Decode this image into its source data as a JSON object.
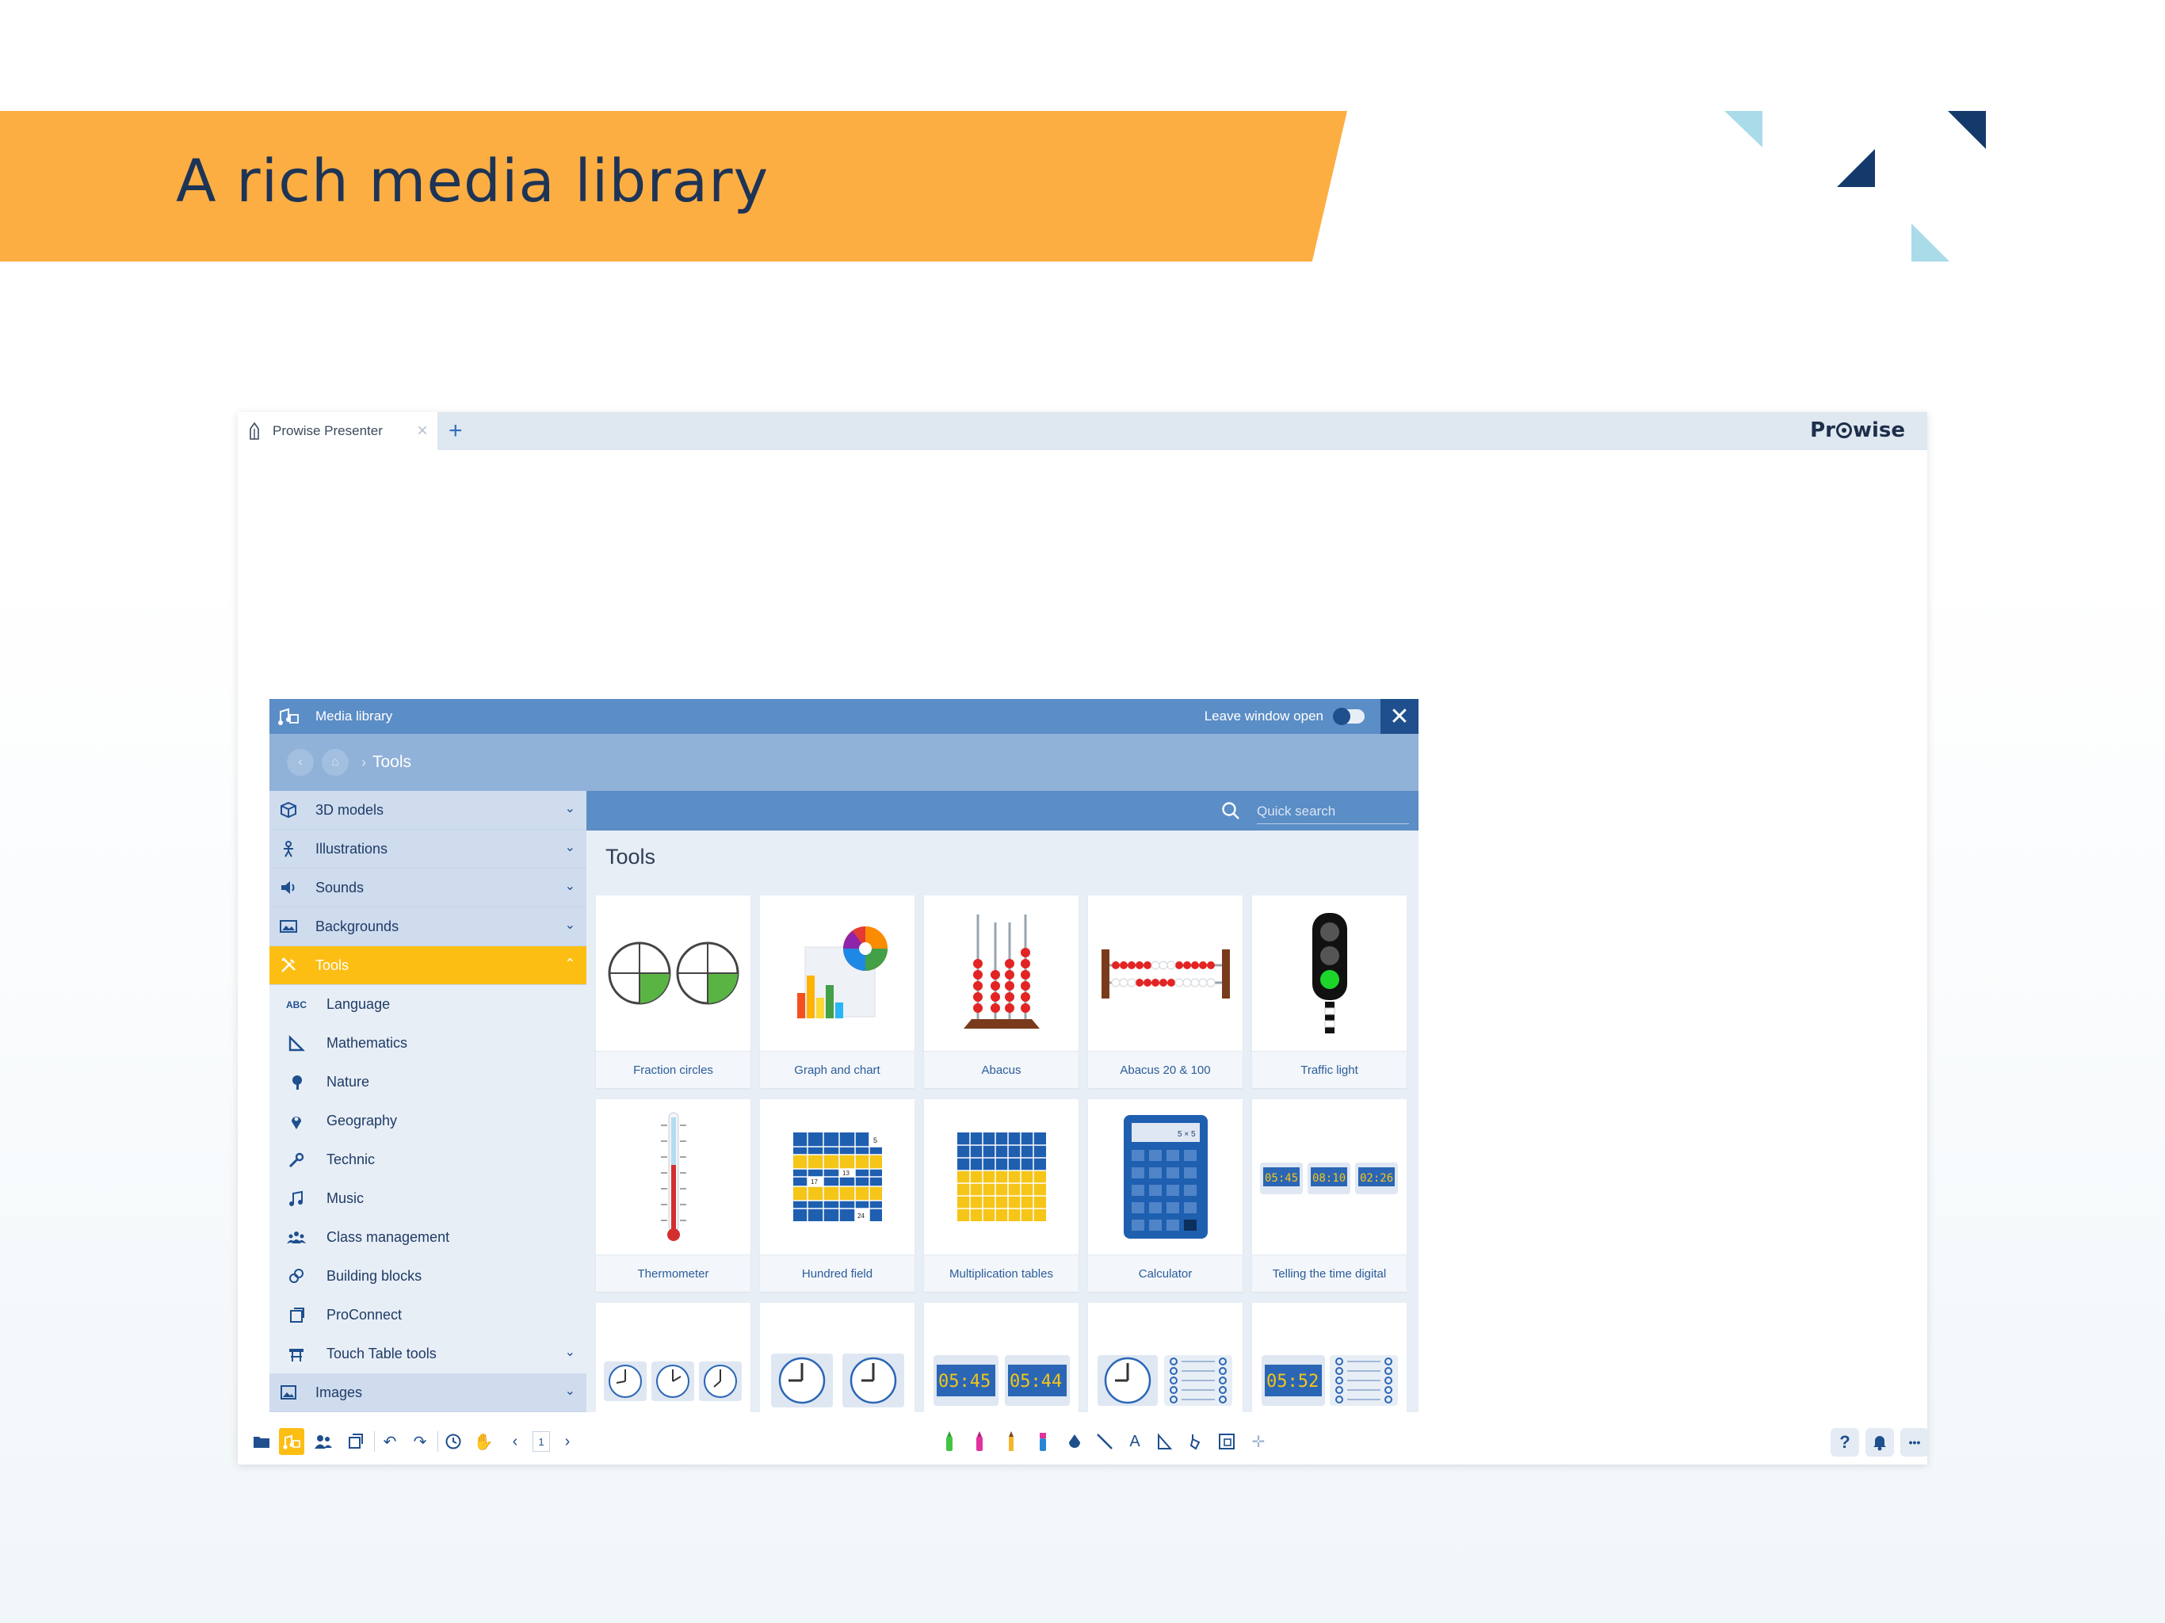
{
  "slide": {
    "title": "A rich media library",
    "accent": "#fdae42",
    "dark": "#143a6b",
    "light": "#a9dbe9"
  },
  "browser": {
    "tab_title": "Prowise Presenter",
    "add_tab": "+",
    "close_tab": "×",
    "brand_left": "Pr",
    "brand_right": "wise"
  },
  "media_library": {
    "title": "Media library",
    "leave_window_label": "Leave window open",
    "leave_window_on": false,
    "close": "✕",
    "breadcrumb": "Tools",
    "search_placeholder": "Quick search",
    "section_title": "Tools",
    "sidebar": [
      {
        "label": "3D models",
        "icon": "cube-icon",
        "level": "top",
        "state": "collapsed"
      },
      {
        "label": "Illustrations",
        "icon": "figure-icon",
        "level": "top",
        "state": "collapsed"
      },
      {
        "label": "Sounds",
        "icon": "speaker-icon",
        "level": "top",
        "state": "collapsed"
      },
      {
        "label": "Backgrounds",
        "icon": "landscape-icon",
        "level": "top",
        "state": "collapsed"
      },
      {
        "label": "Tools",
        "icon": "tools-icon",
        "level": "top",
        "state": "expanded"
      },
      {
        "label": "Language",
        "icon": "abc-icon",
        "level": "sub"
      },
      {
        "label": "Mathematics",
        "icon": "set-square-icon",
        "level": "sub"
      },
      {
        "label": "Nature",
        "icon": "tree-icon",
        "level": "sub"
      },
      {
        "label": "Geography",
        "icon": "location-pin-icon",
        "level": "sub"
      },
      {
        "label": "Technic",
        "icon": "wrench-icon",
        "level": "sub"
      },
      {
        "label": "Music",
        "icon": "music-note-icon",
        "level": "sub"
      },
      {
        "label": "Class management",
        "icon": "group-icon",
        "level": "sub"
      },
      {
        "label": "Building blocks",
        "icon": "blocks-icon",
        "level": "sub"
      },
      {
        "label": "ProConnect",
        "icon": "proconnect-icon",
        "level": "sub"
      },
      {
        "label": "Touch Table tools",
        "icon": "table-icon",
        "level": "sub",
        "state": "collapsed"
      },
      {
        "label": "Images",
        "icon": "image-icon",
        "level": "top",
        "state": "collapsed"
      }
    ],
    "tools": [
      {
        "label": "Fraction circles",
        "icon": "fraction-circles-icon"
      },
      {
        "label": "Graph and chart",
        "icon": "graph-chart-icon"
      },
      {
        "label": "Abacus",
        "icon": "abacus-icon"
      },
      {
        "label": "Abacus 20 & 100",
        "icon": "abacus-horizontal-icon"
      },
      {
        "label": "Traffic light",
        "icon": "traffic-light-icon"
      },
      {
        "label": "Thermometer",
        "icon": "thermometer-icon"
      },
      {
        "label": "Hundred field",
        "icon": "hundred-field-icon"
      },
      {
        "label": "Multiplication tables",
        "icon": "multiplication-grid-icon"
      },
      {
        "label": "Calculator",
        "icon": "calculator-icon"
      },
      {
        "label": "Telling the time digital",
        "icon": "digital-clocks-icon"
      },
      {
        "label": "",
        "icon": "analog-clocks-icon"
      },
      {
        "label": "",
        "icon": "analog-clock-pair-icon"
      },
      {
        "label": "",
        "icon": "digital-clock-pair-icon"
      },
      {
        "label": "",
        "icon": "clock-schedule-icon"
      },
      {
        "label": "",
        "icon": "digital-clock-schedule-icon"
      }
    ],
    "grid_numbers": {
      "n5": "5",
      "n13": "13",
      "n17": "17",
      "n24": "24",
      "calc_display": "5 × 5"
    },
    "clock_times": [
      "05:45",
      "08:10",
      "02:26",
      "05:45",
      "05:44",
      "05:52"
    ]
  },
  "toolbar": {
    "page_number": "1",
    "help": "?",
    "more": "•••"
  }
}
